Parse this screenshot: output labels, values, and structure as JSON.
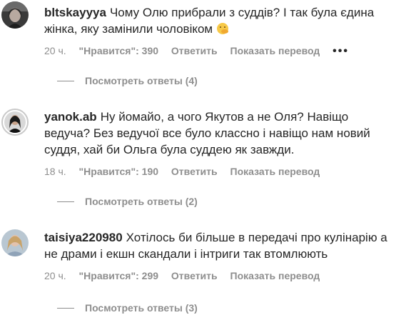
{
  "comments": [
    {
      "username": "bltskayyya",
      "text": "Чому Олю прибрали з суддів? І так була єдина жінка, яку замінили чоловіком",
      "emoji_icon": "smiling-face-with-hand-over-mouth-icon",
      "time": "20 ч.",
      "likes": "\"Нравится\": 390",
      "reply_label": "Ответить",
      "translate_label": "Показать перевод",
      "more_label": "•••",
      "view_replies": "Посмотреть ответы (4)"
    },
    {
      "username": "yanok.ab",
      "text": "Ну йомайо, а чого Якутов а не Оля? Навіщо ведуча? Без ведучої все було классно і навіщо нам новий суддя, хай би Ольга була суддею як завжди.",
      "time": "18 ч.",
      "likes": "\"Нравится\": 190",
      "reply_label": "Ответить",
      "translate_label": "Показать перевод",
      "view_replies": "Посмотреть ответы (2)"
    },
    {
      "username": "taisiya220980",
      "text": "Хотілось би більше в передачі про кулінарію а не драми і екшн скандали і інтриги так втомлюють",
      "time": "20 ч.",
      "likes": "\"Нравится\": 299",
      "reply_label": "Ответить",
      "translate_label": "Показать перевод",
      "view_replies": "Посмотреть ответы (3)"
    }
  ]
}
